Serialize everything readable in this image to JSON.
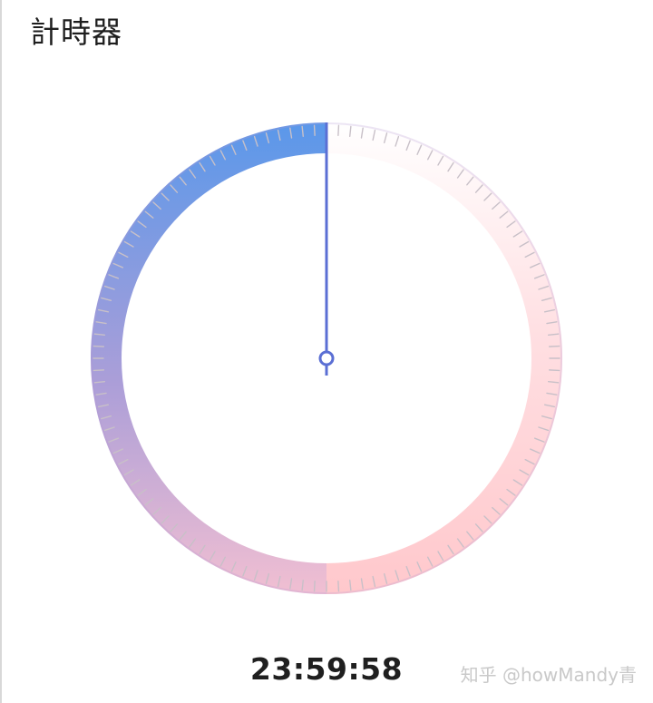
{
  "app": {
    "title": "計時器"
  },
  "timer": {
    "display": "23:59:58",
    "elapsed_fraction": 0.0,
    "tick_count": 120,
    "track_gradient": {
      "start": "#5a98ea",
      "mid": "#d9a6d9",
      "end": "#ffc9cc",
      "fade": "#ffffff"
    },
    "hand_color": "#5b6fd4",
    "tick_color": "#c8c0c8"
  },
  "watermark": {
    "text": "知乎 @howMandy青"
  }
}
